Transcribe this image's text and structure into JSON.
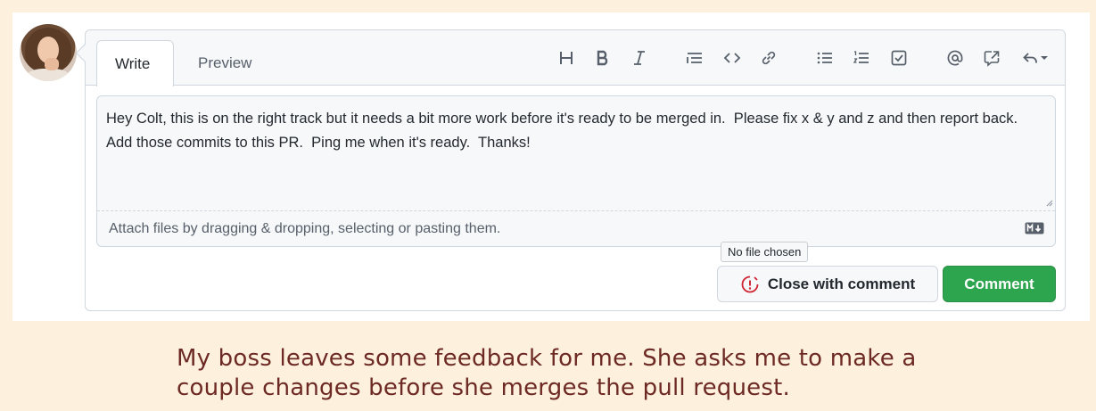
{
  "tabs": {
    "write": "Write",
    "preview": "Preview"
  },
  "toolbar": {
    "icons": [
      "heading-icon",
      "bold-icon",
      "italic-icon",
      "quote-icon",
      "code-icon",
      "link-icon",
      "bulleted-list-icon",
      "numbered-list-icon",
      "task-list-icon",
      "mention-icon",
      "reference-icon",
      "reply-icon"
    ]
  },
  "editor": {
    "text": "Hey Colt, this is on the right track but it needs a bit more work before it's ready to be merged in.  Please fix x & y and z and then report back.  Add those commits to this PR.  Ping me when it's ready.  Thanks!"
  },
  "attach": {
    "label": "Attach files by dragging & dropping, selecting or pasting them."
  },
  "file_input": {
    "tooltip": "No file chosen"
  },
  "actions": {
    "close_label": "Close with comment",
    "comment_label": "Comment"
  },
  "caption": {
    "line1": "My boss leaves some feedback for me.  She asks me to make a",
    "line2": "couple changes before she merges the pull request."
  },
  "colors": {
    "accent_green": "#2da44e",
    "close_icon_red": "#cf222e",
    "caption": "#6d2a24",
    "background": "#fdf0dc"
  }
}
